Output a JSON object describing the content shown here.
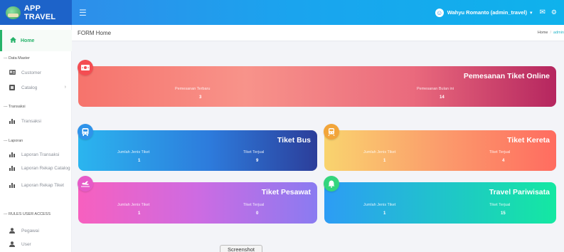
{
  "app": {
    "name": "APP TRAVEL"
  },
  "topbar": {
    "menu_icon": "hamburger-icon",
    "user_name": "Wahyu Romanto (admin_travel)",
    "user_caret": "▾",
    "mail_icon": "mail-icon"
  },
  "sidebar": {
    "home": {
      "label": "Home",
      "icon": "home-icon"
    },
    "sections": [
      {
        "heading": "--- Data Master",
        "items": [
          {
            "label": "Customer",
            "icon": "id-card-icon"
          },
          {
            "label": "Catalog",
            "icon": "catalog-icon",
            "has_children": true
          }
        ]
      },
      {
        "heading": "--- Transaksi",
        "items": [
          {
            "label": "Transaksi",
            "icon": "chart-icon"
          }
        ]
      },
      {
        "heading": "--- Laporan",
        "items": [
          {
            "label": "Laporan Transaksi",
            "icon": "chart-icon"
          },
          {
            "label": "Laporan Rekap Catalog",
            "icon": "chart-icon"
          },
          {
            "label": "Laporan Rekap Tiket",
            "icon": "chart-icon"
          }
        ]
      },
      {
        "heading": "--- RULES USER ACCESS",
        "items": [
          {
            "label": "Pegawai",
            "icon": "user-icon"
          },
          {
            "label": "User",
            "icon": "user-icon"
          }
        ]
      }
    ]
  },
  "header": {
    "title": "FORM Home",
    "breadcrumb": [
      "Home",
      "admin"
    ]
  },
  "cards": {
    "online": {
      "title": "Pemesanan Tiket Online",
      "icon": "money-icon",
      "stat1_label": "Pemesanan Terbaru",
      "stat1_value": "3",
      "stat2_label": "Pemesanan Bulan ini",
      "stat2_value": "14"
    },
    "bus": {
      "title": "Tiket Bus",
      "icon": "bus-icon",
      "stat1_label": "Jumlah Jenis Tiket",
      "stat1_value": "1",
      "stat2_label": "Tiket Terjual",
      "stat2_value": "9"
    },
    "kereta": {
      "title": "Tiket Kereta",
      "icon": "train-icon",
      "stat1_label": "Jumlah Jenis Tiket",
      "stat1_value": "1",
      "stat2_label": "Tiket Terjual",
      "stat2_value": "4"
    },
    "pesawat": {
      "title": "Tiket Pesawat",
      "icon": "plane-icon",
      "stat1_label": "Jumlah Jenis Tiket",
      "stat1_value": "1",
      "stat2_label": "Tiket Terjual",
      "stat2_value": "0"
    },
    "wisata": {
      "title": "Travel Pariwisata",
      "icon": "bell-icon",
      "stat1_label": "Jumlah Jenis Tiket",
      "stat1_value": "1",
      "stat2_label": "Tiket Terjual",
      "stat2_value": "15"
    }
  },
  "tooltip": {
    "label": "Screenshot"
  },
  "colors": {
    "brand": "#1d63c9",
    "accent_green": "#27b36a",
    "navbar_from": "#2e8eea",
    "navbar_to": "#0fb2ec"
  }
}
